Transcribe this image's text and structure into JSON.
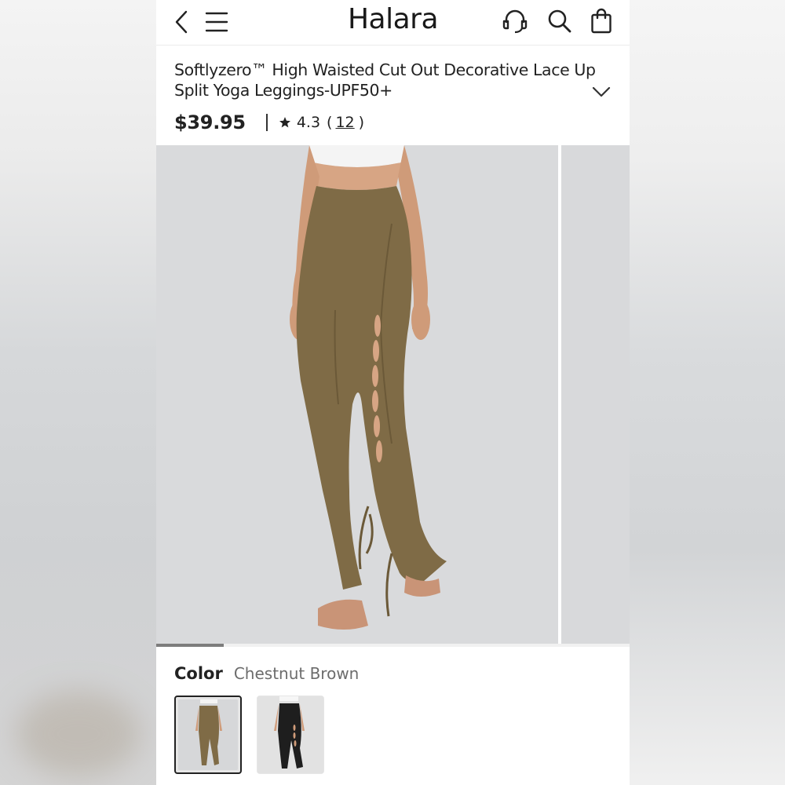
{
  "header": {
    "brand": "Halara",
    "icons": [
      "back-arrow-icon",
      "menu-icon",
      "headset-icon",
      "search-icon",
      "shopping-bag-icon"
    ]
  },
  "product": {
    "title": "Softlyzero™ High Waisted Cut Out Decorative Lace Up Split Yoga Leggings-UPF50+",
    "price": "$39.95",
    "rating": "4.3",
    "open_paren": "(",
    "review_count": "12",
    "close_paren": ")"
  },
  "gallery": {
    "current_index": 1,
    "progress_fraction": 0.143
  },
  "color": {
    "label": "Color",
    "selected": "Chestnut Brown",
    "swatches": [
      {
        "name": "Chestnut Brown",
        "selected": true
      },
      {
        "name": "Black",
        "selected": false
      }
    ]
  },
  "colors": {
    "primary_text": "#222222",
    "secondary_text": "#6c6c6c",
    "legging_brown": "#7f6b46",
    "image_bg": "#d9dadc"
  }
}
